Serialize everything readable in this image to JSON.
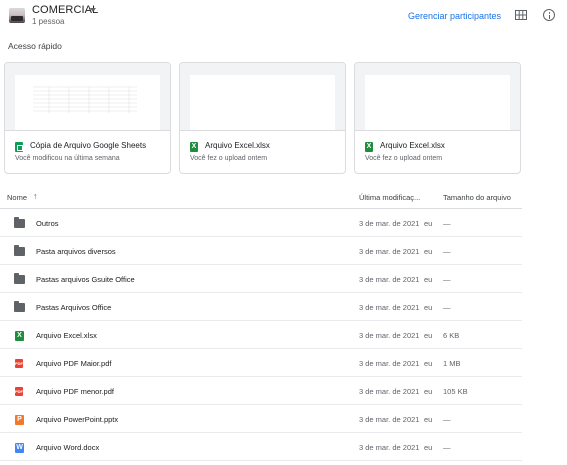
{
  "header": {
    "drive_name": "COMERCIAL",
    "members": "1 pessoa",
    "manage_label": "Gerenciar participantes",
    "grid_icon": "grid-view-icon",
    "info_icon": "info-icon",
    "link_color": "#1a73e8"
  },
  "quick_access": {
    "title": "Acesso rápido",
    "cards": [
      {
        "name": "Cópia de Arquivo Google Sheets",
        "subtitle": "Você modificou na última semana",
        "icon": "google-sheets-icon",
        "icon_color": "#0f9d58"
      },
      {
        "name": "Arquivo Excel.xlsx",
        "subtitle": "Você fez o upload ontem",
        "icon": "excel-icon",
        "icon_color": "#1e8e3e"
      },
      {
        "name": "Arquivo Excel.xlsx",
        "subtitle": "Você fez o upload ontem",
        "icon": "excel-icon",
        "icon_color": "#1e8e3e"
      }
    ]
  },
  "file_list": {
    "columns": {
      "name": "Nome",
      "modified": "Última modificaç...",
      "size": "Tamanho do arquivo"
    },
    "sort_icon": "arrow-up-icon",
    "rows": [
      {
        "name": "Outros",
        "modified": "3 de mar. de 2021",
        "owner": "eu",
        "size": "—",
        "icon": "folder-icon"
      },
      {
        "name": "Pasta arquivos diversos",
        "modified": "3 de mar. de 2021",
        "owner": "eu",
        "size": "—",
        "icon": "folder-icon"
      },
      {
        "name": "Pastas arquivos Gsuite Office",
        "modified": "3 de mar. de 2021",
        "owner": "eu",
        "size": "—",
        "icon": "folder-icon"
      },
      {
        "name": "Pastas Arquivos Office",
        "modified": "3 de mar. de 2021",
        "owner": "eu",
        "size": "—",
        "icon": "folder-icon"
      },
      {
        "name": "Arquivo Excel.xlsx",
        "modified": "3 de mar. de 2021",
        "owner": "eu",
        "size": "6 KB",
        "icon": "excel-icon"
      },
      {
        "name": "Arquivo PDF Maior.pdf",
        "modified": "3 de mar. de 2021",
        "owner": "eu",
        "size": "1 MB",
        "icon": "pdf-icon"
      },
      {
        "name": "Arquivo PDF menor.pdf",
        "modified": "3 de mar. de 2021",
        "owner": "eu",
        "size": "105 KB",
        "icon": "pdf-icon"
      },
      {
        "name": "Arquivo PowerPoint.pptx",
        "modified": "3 de mar. de 2021",
        "owner": "eu",
        "size": "—",
        "icon": "powerpoint-icon"
      },
      {
        "name": "Arquivo Word.docx",
        "modified": "3 de mar. de 2021",
        "owner": "eu",
        "size": "—",
        "icon": "word-icon"
      }
    ]
  }
}
